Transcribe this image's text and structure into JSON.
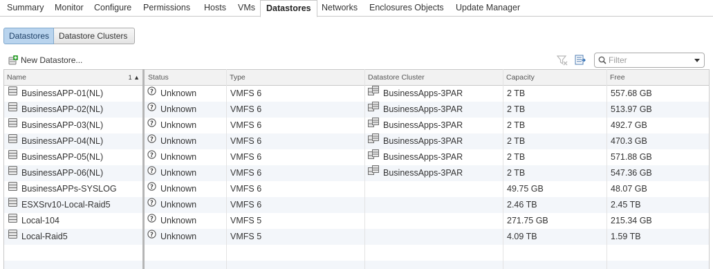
{
  "tabs": [
    {
      "label": "Summary",
      "active": false
    },
    {
      "label": "Monitor",
      "active": false
    },
    {
      "label": "Configure",
      "active": false
    },
    {
      "label": "Permissions",
      "active": false
    },
    {
      "label": "Hosts",
      "active": false
    },
    {
      "label": "VMs",
      "active": false
    },
    {
      "label": "Datastores",
      "active": true
    },
    {
      "label": "Networks",
      "active": false
    },
    {
      "label": "Enclosures Objects",
      "active": false
    },
    {
      "label": "Update Manager",
      "active": false
    }
  ],
  "subtabs": [
    {
      "label": "Datastores",
      "active": true
    },
    {
      "label": "Datastore Clusters",
      "active": false
    }
  ],
  "toolbar": {
    "new_datastore_label": "New Datastore...",
    "icons": [
      "new-datastore-icon",
      "clear-filter-icon",
      "export-list-icon"
    ]
  },
  "filter": {
    "placeholder": "Filter",
    "value": ""
  },
  "grid": {
    "sort_indicator": "1 ▲",
    "columns": [
      "Name",
      "Status",
      "Type",
      "Datastore Cluster",
      "Capacity",
      "Free"
    ],
    "rows": [
      {
        "name": "BusinessAPP-01(NL)",
        "status": "Unknown",
        "type": "VMFS 6",
        "cluster": "BusinessApps-3PAR",
        "capacity": "2 TB",
        "free": "557.68 GB"
      },
      {
        "name": "BusinessAPP-02(NL)",
        "status": "Unknown",
        "type": "VMFS 6",
        "cluster": "BusinessApps-3PAR",
        "capacity": "2 TB",
        "free": "513.97 GB"
      },
      {
        "name": "BusinessAPP-03(NL)",
        "status": "Unknown",
        "type": "VMFS 6",
        "cluster": "BusinessApps-3PAR",
        "capacity": "2 TB",
        "free": "492.7 GB"
      },
      {
        "name": "BusinessAPP-04(NL)",
        "status": "Unknown",
        "type": "VMFS 6",
        "cluster": "BusinessApps-3PAR",
        "capacity": "2 TB",
        "free": "470.3 GB"
      },
      {
        "name": "BusinessAPP-05(NL)",
        "status": "Unknown",
        "type": "VMFS 6",
        "cluster": "BusinessApps-3PAR",
        "capacity": "2 TB",
        "free": "571.88 GB"
      },
      {
        "name": "BusinessAPP-06(NL)",
        "status": "Unknown",
        "type": "VMFS 6",
        "cluster": "BusinessApps-3PAR",
        "capacity": "2 TB",
        "free": "547.36 GB"
      },
      {
        "name": "BusinessAPPs-SYSLOG",
        "status": "Unknown",
        "type": "VMFS 6",
        "cluster": "",
        "capacity": "49.75 GB",
        "free": "48.07 GB"
      },
      {
        "name": "ESXSrv10-Local-Raid5",
        "status": "Unknown",
        "type": "VMFS 6",
        "cluster": "",
        "capacity": "2.46 TB",
        "free": "2.45 TB"
      },
      {
        "name": "Local-104",
        "status": "Unknown",
        "type": "VMFS 5",
        "cluster": "",
        "capacity": "271.75 GB",
        "free": "215.34 GB"
      },
      {
        "name": "Local-Raid5",
        "status": "Unknown",
        "type": "VMFS 5",
        "cluster": "",
        "capacity": "4.09 TB",
        "free": "1.59 TB"
      }
    ]
  },
  "colors": {
    "active_segment_bg": "#b9d4ee",
    "alt_row_bg": "#f3f6fa",
    "header_bg": "#f2f2f2"
  }
}
